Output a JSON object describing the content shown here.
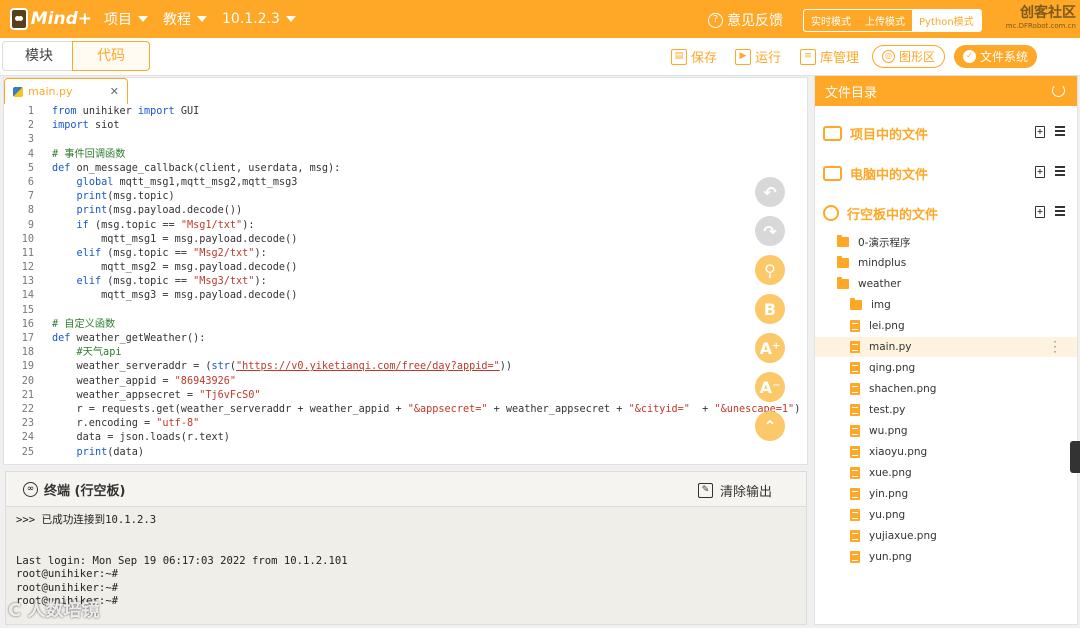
{
  "app": {
    "logo": "Mind+",
    "menu": [
      "项目",
      "教程",
      "10.1.2.3"
    ],
    "feedback": "意见反馈",
    "modes": [
      "实时模式",
      "上传模式",
      "Python模式"
    ],
    "community": "创客社区",
    "community_url": "mc.DFRobot.com.cn"
  },
  "subbar": {
    "tabs": [
      "模块",
      "代码"
    ],
    "save": "保存",
    "run": "运行",
    "lib": "库管理",
    "graph": "图形区",
    "files": "文件系统"
  },
  "editor": {
    "filename": "main.py",
    "lines": [
      {
        "n": "1",
        "html": "<span class=\"kw\">from</span> unihiker <span class=\"kw\">import</span> GUI"
      },
      {
        "n": "2",
        "html": "<span class=\"kw\">import</span> siot"
      },
      {
        "n": "3",
        "html": ""
      },
      {
        "n": "4",
        "html": "<span class=\"cm\"># 事件回调函数</span>"
      },
      {
        "n": "5",
        "html": "<span class=\"kw\">def</span> on_message_callback(client, userdata, msg):"
      },
      {
        "n": "6",
        "html": "    <span class=\"kw\">global</span> mqtt_msg1,mqtt_msg2,mqtt_msg3"
      },
      {
        "n": "7",
        "html": "    <span class=\"kw\">print</span>(msg.topic)"
      },
      {
        "n": "8",
        "html": "    <span class=\"kw\">print</span>(msg.payload.decode())"
      },
      {
        "n": "9",
        "html": "    <span class=\"kw\">if</span> (msg.topic == <span class=\"str\">\"Msg1/txt\"</span>):"
      },
      {
        "n": "10",
        "html": "        mqtt_msg1 = msg.payload.decode()"
      },
      {
        "n": "11",
        "html": "    <span class=\"kw\">elif</span> (msg.topic == <span class=\"str\">\"Msg2/txt\"</span>):"
      },
      {
        "n": "12",
        "html": "        mqtt_msg2 = msg.payload.decode()"
      },
      {
        "n": "13",
        "html": "    <span class=\"kw\">elif</span> (msg.topic == <span class=\"str\">\"Msg3/txt\"</span>):"
      },
      {
        "n": "14",
        "html": "        mqtt_msg3 = msg.payload.decode()"
      },
      {
        "n": "15",
        "html": ""
      },
      {
        "n": "16",
        "html": "<span class=\"cm\"># 自定义函数</span>"
      },
      {
        "n": "17",
        "html": "<span class=\"kw\">def</span> weather_getWeather():"
      },
      {
        "n": "18",
        "html": "    <span class=\"cm\">#天气api</span>"
      },
      {
        "n": "19",
        "html": "    weather_serveraddr = (<span class=\"kw\">str</span>(<span class=\"url\">\"https://v0.yiketianqi.com/free/day?appid=\"</span>))"
      },
      {
        "n": "20",
        "html": "    weather_appid = <span class=\"str\">\"86943926\"</span>"
      },
      {
        "n": "21",
        "html": "    weather_appsecret = <span class=\"str\">\"Tj6vFcS0\"</span>"
      },
      {
        "n": "22",
        "html": "    r = requests.get(weather_serveraddr + weather_appid + <span class=\"str\">\"&amp;appsecret=\"</span> + weather_appsecret + <span class=\"str\">\"&amp;cityid=\"</span>  + <span class=\"str\">\"&amp;unescape=1\"</span>)"
      },
      {
        "n": "23",
        "html": "    r.encoding = <span class=\"str\">\"utf-8\"</span>"
      },
      {
        "n": "24",
        "html": "    data = json.loads(r.text)"
      },
      {
        "n": "25",
        "html": "    <span class=\"kw\">print</span>(data)"
      }
    ]
  },
  "terminal": {
    "title": "终端 (行空板)",
    "clear": "清除输出",
    "lines": [
      ">>> 已成功连接到10.1.2.3",
      "",
      "",
      "Last login: Mon Sep 19 06:17:03 2022 from 10.1.2.101",
      "root@unihiker:~#",
      "root@unihiker:~#",
      "root@unihiker:~#"
    ]
  },
  "files": {
    "title": "文件目录",
    "sections": [
      "项目中的文件",
      "电脑中的文件",
      "行空板中的文件"
    ],
    "tree": [
      {
        "name": "0-演示程序",
        "type": "folder",
        "indent": 0
      },
      {
        "name": "mindplus",
        "type": "folder",
        "indent": 0
      },
      {
        "name": "weather",
        "type": "folder-open",
        "indent": 0
      },
      {
        "name": "img",
        "type": "folder",
        "indent": 1
      },
      {
        "name": "lei.png",
        "type": "file",
        "indent": 1
      },
      {
        "name": "main.py",
        "type": "file",
        "indent": 1,
        "selected": true
      },
      {
        "name": "qing.png",
        "type": "file",
        "indent": 1
      },
      {
        "name": "shachen.png",
        "type": "file",
        "indent": 1
      },
      {
        "name": "test.py",
        "type": "file",
        "indent": 1
      },
      {
        "name": "wu.png",
        "type": "file",
        "indent": 1
      },
      {
        "name": "xiaoyu.png",
        "type": "file",
        "indent": 1
      },
      {
        "name": "xue.png",
        "type": "file",
        "indent": 1
      },
      {
        "name": "yin.png",
        "type": "file",
        "indent": 1
      },
      {
        "name": "yu.png",
        "type": "file",
        "indent": 1
      },
      {
        "name": "yujiaxue.png",
        "type": "file",
        "indent": 1
      },
      {
        "name": "yun.png",
        "type": "file",
        "indent": 1
      }
    ]
  },
  "watermark": "C 人数培镜"
}
